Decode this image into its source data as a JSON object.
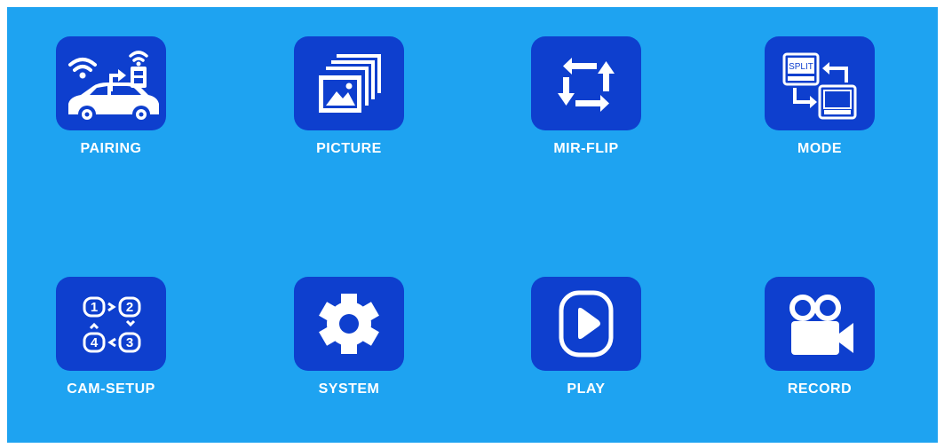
{
  "colors": {
    "screen_background": "#1ea3f1",
    "tile_background": "#0e3fce",
    "foreground": "#ffffff"
  },
  "menu": {
    "items": [
      {
        "label": "PAIRING",
        "icon": "car-wireless-pairing-icon"
      },
      {
        "label": "PICTURE",
        "icon": "picture-stack-icon"
      },
      {
        "label": "MIR-FLIP",
        "icon": "mirror-flip-arrows-icon"
      },
      {
        "label": "MODE",
        "icon": "split-mode-icon",
        "icon_text": "SPLIT"
      },
      {
        "label": "CAM-SETUP",
        "icon": "camera-sequence-icon",
        "icon_numbers": [
          "1",
          "2",
          "4",
          "3"
        ]
      },
      {
        "label": "SYSTEM",
        "icon": "gear-icon"
      },
      {
        "label": "PLAY",
        "icon": "play-icon"
      },
      {
        "label": "RECORD",
        "icon": "video-camera-icon"
      }
    ]
  }
}
